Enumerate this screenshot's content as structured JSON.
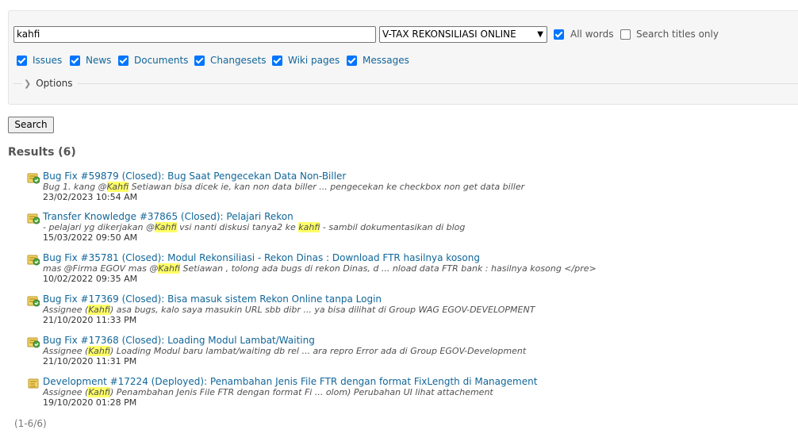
{
  "search": {
    "query": "kahfi",
    "scope": "V-TAX REKONSILIASI ONLINE",
    "all_words_label": "All words",
    "all_words_checked": true,
    "titles_only_label": "Search titles only",
    "titles_only_checked": false,
    "filters": [
      {
        "label": "Issues",
        "checked": true
      },
      {
        "label": "News",
        "checked": true
      },
      {
        "label": "Documents",
        "checked": true
      },
      {
        "label": "Changesets",
        "checked": true
      },
      {
        "label": "Wiki pages",
        "checked": true
      },
      {
        "label": "Messages",
        "checked": true
      }
    ],
    "options_label": "Options",
    "button_label": "Search"
  },
  "results": {
    "heading": "Results",
    "count": "(6)",
    "items": [
      {
        "title": "Bug Fix #59879 (Closed): Bug Saat Pengecekan Data Non-Biller",
        "desc": [
          {
            "t": "Bug 1. kang @",
            "hl": false
          },
          {
            "t": "Kahfi",
            "hl": true
          },
          {
            "t": " Setiawan bisa dicek ie, kan non data biller ... pengecekan ke checkbox non get data biller",
            "hl": false
          }
        ],
        "date": "23/02/2023 10:54 AM",
        "icon": "bug-issue-icon"
      },
      {
        "title": "Transfer Knowledge #37865 (Closed): Pelajari Rekon",
        "desc": [
          {
            "t": "- pelajari yg dikerjakan @",
            "hl": false
          },
          {
            "t": "Kahfi",
            "hl": true
          },
          {
            "t": " vsi nanti diskusi tanya2 ke ",
            "hl": false
          },
          {
            "t": "kahfi",
            "hl": true
          },
          {
            "t": " - sambil dokumentasikan di blog",
            "hl": false
          }
        ],
        "date": "15/03/2022 09:50 AM",
        "icon": "closed-issue-icon"
      },
      {
        "title": "Bug Fix #35781 (Closed): Modul Rekonsiliasi - Rekon Dinas : Download FTR hasilnya kosong",
        "desc": [
          {
            "t": "mas @Firma EGOV mas @",
            "hl": false
          },
          {
            "t": "Kahfi",
            "hl": true
          },
          {
            "t": " Setiawan , tolong ada bugs di rekon Dinas, d ... nload data FTR bank : hasilnya kosong </pre>",
            "hl": false
          }
        ],
        "date": "10/02/2022 09:35 AM",
        "icon": "bug-issue-icon"
      },
      {
        "title": "Bug Fix #17369 (Closed): Bisa masuk sistem Rekon Online tanpa Login",
        "desc": [
          {
            "t": "Assignee (",
            "hl": false
          },
          {
            "t": "Kahfi",
            "hl": true
          },
          {
            "t": ") asa bugs, kalo saya masukin URL sbb dibr ... ya bisa dilihat di Group WAG EGOV-DEVELOPMENT",
            "hl": false
          }
        ],
        "date": "21/10/2020 11:33 PM",
        "icon": "bug-issue-icon"
      },
      {
        "title": "Bug Fix #17368 (Closed): Loading Modul Lambat/Waiting",
        "desc": [
          {
            "t": "Assignee (",
            "hl": false
          },
          {
            "t": "Kahfi",
            "hl": true
          },
          {
            "t": ") Loading Modul baru lambat/waiting db rel ... ara repro Error ada di Group EGOV-Development",
            "hl": false
          }
        ],
        "date": "21/10/2020 11:31 PM",
        "icon": "bug-issue-icon"
      },
      {
        "title": "Development #17224 (Deployed): Penambahan Jenis File FTR dengan format FixLength di Management",
        "desc": [
          {
            "t": "Assignee (",
            "hl": false
          },
          {
            "t": "Kahfi",
            "hl": true
          },
          {
            "t": ") Penambahan Jenis File FTR dengan format Fi ... olom) Perubahan UI lihat attachement",
            "hl": false
          }
        ],
        "date": "19/10/2020 01:28 PM",
        "icon": "issue-icon"
      }
    ]
  },
  "pagination": "(1-6/6)"
}
